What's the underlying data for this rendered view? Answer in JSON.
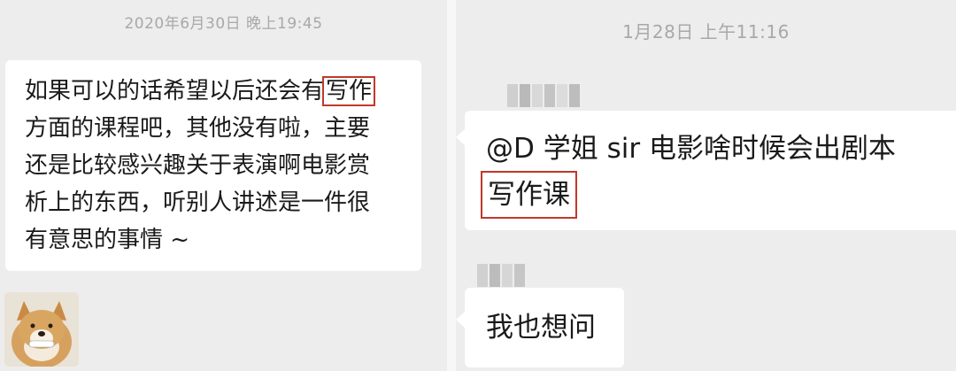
{
  "left_chat": {
    "timestamp": "2020年6月30日 晚上19:45",
    "message": {
      "line1_before": "如果可以的话希望以后还会有",
      "line1_highlight": "写作",
      "line2": "方面的课程吧，其他没有啦，主要",
      "line3": "还是比较感兴趣关于表演啊电影赏",
      "line4": "析上的东西，听别人讲述是一件很",
      "line5": "有意思的事情 ~"
    },
    "avatar_icon": "dog-avatar-icon"
  },
  "right_chat": {
    "timestamp": "1月28日 上午11:16",
    "message1": {
      "line1": "@D 学姐  sir 电影啥时候会出剧本",
      "line2_highlight": "写作课"
    },
    "message2": "我也想问"
  },
  "colors": {
    "background": "#ededed",
    "bubble": "#ffffff",
    "highlight_border": "#c0392b",
    "timestamp": "#a8a8a8"
  }
}
